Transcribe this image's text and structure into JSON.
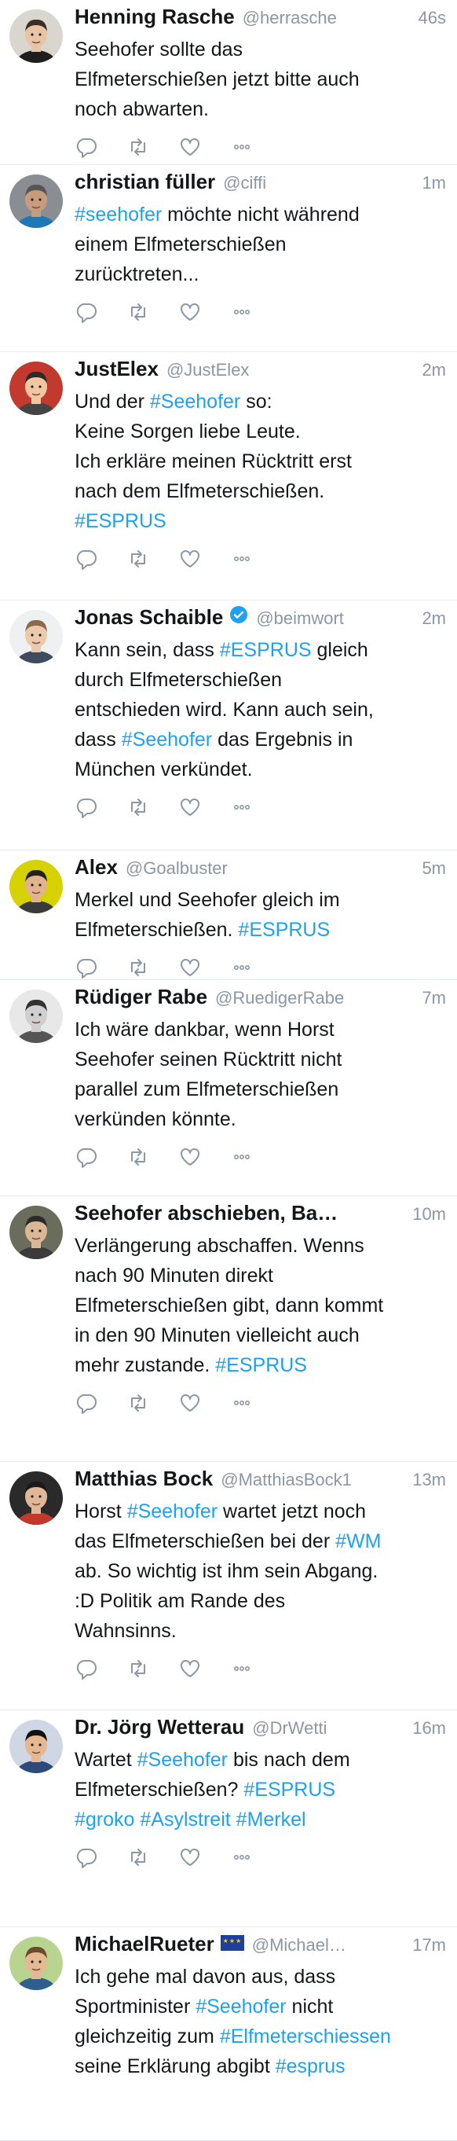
{
  "tweets": [
    {
      "name": "Henning Rasche",
      "handle": "@herrasche",
      "time": "46s",
      "avatar": "avatar-henning",
      "verified": false,
      "flag": false,
      "lines": [
        [
          "Seehofer sollte das"
        ],
        [
          "Elfmeterschießen jetzt bitte auch"
        ],
        [
          "noch abwarten."
        ]
      ]
    },
    {
      "name": "christian füller",
      "handle": "@ciffi",
      "time": "1m",
      "avatar": "avatar-christian",
      "verified": false,
      "flag": false,
      "lines": [
        [
          "#seehofer",
          " möchte nicht während"
        ],
        [
          "einem Elfmeterschießen"
        ],
        [
          "zurücktreten..."
        ]
      ]
    },
    {
      "name": "JustElex",
      "handle": "@JustElex",
      "time": "2m",
      "avatar": "avatar-justelex",
      "verified": false,
      "flag": false,
      "lines": [
        [
          "Und der ",
          "#Seehofer",
          " so:"
        ],
        [
          "Keine Sorgen liebe Leute."
        ],
        [
          "Ich erkläre meinen Rücktritt erst"
        ],
        [
          "nach dem Elfmeterschießen."
        ],
        [
          "#ESPRUS"
        ]
      ]
    },
    {
      "name": "Jonas Schaible",
      "handle": "@beimwort",
      "time": "2m",
      "avatar": "avatar-jonas",
      "verified": true,
      "flag": false,
      "lines": [
        [
          "Kann sein, dass ",
          "#ESPRUS",
          " gleich"
        ],
        [
          "durch Elfmeterschießen"
        ],
        [
          "entschieden wird. Kann auch sein,"
        ],
        [
          "dass ",
          "#Seehofer",
          " das Ergebnis in"
        ],
        [
          "München verkündet."
        ]
      ]
    },
    {
      "name": "Alex",
      "handle": "@Goalbuster",
      "time": "5m",
      "avatar": "avatar-alex",
      "verified": false,
      "flag": false,
      "lines": [
        [
          "Merkel und Seehofer gleich im"
        ],
        [
          "Elfmeterschießen. ",
          "#ESPRUS"
        ]
      ]
    },
    {
      "name": "Rüdiger Rabe",
      "handle": "@RuedigerRabe",
      "time": "7m",
      "avatar": "avatar-ruediger",
      "verified": false,
      "flag": false,
      "lines": [
        [
          "Ich wäre dankbar, wenn Horst"
        ],
        [
          "Seehofer seinen Rücktritt nicht"
        ],
        [
          "parallel zum Elfmeterschießen"
        ],
        [
          "verkünden könnte."
        ]
      ]
    },
    {
      "name": "Seehofer abschieben, Ba…",
      "handle": "",
      "time": "10m",
      "avatar": "avatar-seehofer-abschieben",
      "verified": false,
      "flag": false,
      "lines": [
        [
          "Verlängerung abschaffen. Wenns"
        ],
        [
          "nach 90 Minuten direkt"
        ],
        [
          "Elfmeterschießen gibt, dann kommt"
        ],
        [
          "in den 90 Minuten vielleicht auch"
        ],
        [
          "mehr zustande. ",
          "#ESPRUS"
        ]
      ]
    },
    {
      "name": "Matthias Bock",
      "handle": "@MatthiasBock1",
      "time": "13m",
      "avatar": "avatar-matthias",
      "verified": false,
      "flag": false,
      "lines": [
        [
          "Horst ",
          "#Seehofer",
          " wartet jetzt noch"
        ],
        [
          "das Elfmeterschießen bei der ",
          "#WM"
        ],
        [
          "ab. So wichtig ist ihm sein Abgang."
        ],
        [
          ":D Politik am Rande des"
        ],
        [
          "Wahnsinns."
        ]
      ]
    },
    {
      "name": "Dr. Jörg Wetterau",
      "handle": "@DrWetti",
      "time": "16m",
      "avatar": "avatar-joerg",
      "verified": false,
      "flag": false,
      "lines": [
        [
          "Wartet ",
          "#Seehofer",
          " bis nach dem"
        ],
        [
          "Elfmeterschießen? ",
          "#ESPRUS"
        ],
        [
          "#groko",
          " ",
          "#Asylstreit",
          " ",
          "#Merkel"
        ]
      ]
    },
    {
      "name": "MichaelRueter",
      "handle": "@Michael…",
      "time": "17m",
      "avatar": "avatar-michael",
      "verified": false,
      "flag": true,
      "lines": [
        [
          "Ich gehe mal davon aus, dass"
        ],
        [
          "Sportminister ",
          "#Seehofer",
          " nicht"
        ],
        [
          "gleichzeitig zum ",
          "#Elfmeterschiessen"
        ],
        [
          "seine Erklärung abgibt ",
          "#esprus"
        ]
      ]
    }
  ],
  "actions": [
    "reply-icon",
    "retweet-icon",
    "like-icon",
    "more-icon"
  ],
  "colors": {
    "link": "#1da1f2",
    "text": "#14171a",
    "muted": "#8b97a3",
    "divider": "#e6ecf0"
  }
}
